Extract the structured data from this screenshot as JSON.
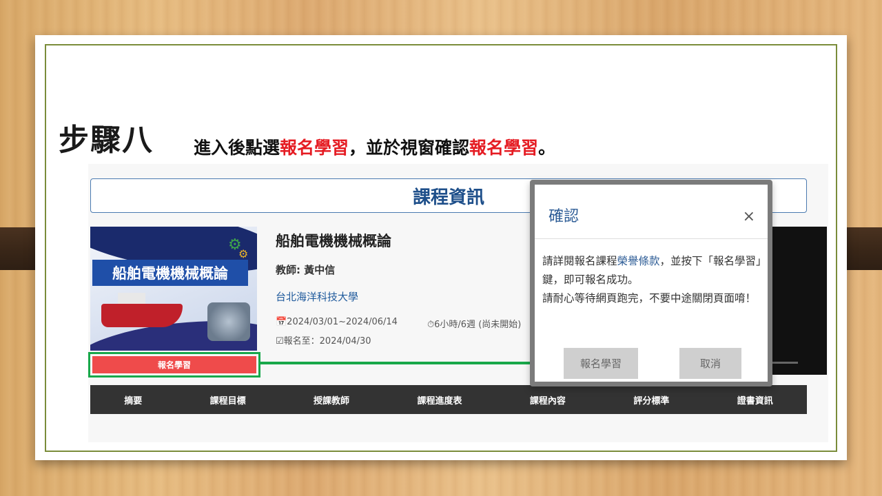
{
  "slide": {
    "step_title": "步驟八",
    "instruction": {
      "part1": "進入後點選",
      "highlight1": "報名學習",
      "part2": "，並於視窗確認",
      "highlight2": "報名學習",
      "part3": "。"
    }
  },
  "course_page": {
    "header": "課程資訊",
    "banner_label": "船舶電機機械概論",
    "course_name": "船舶電機機械概論",
    "teacher": "教師: 黃中信",
    "school": "台北海洋科技大學",
    "dates": "📅2024/03/01~2024/06/14",
    "duration": "⏱6小時/6週 (尚未開始)",
    "deadline": "☑報名至：2024/04/30",
    "enroll_button": "報名學習",
    "tabs": [
      "摘要",
      "課程目標",
      "授課教師",
      "課程進度表",
      "課程內容",
      "評分標準",
      "證書資訊"
    ]
  },
  "modal": {
    "title": "確認",
    "close": "×",
    "body_part1": "請詳閱報名課程",
    "body_link": "榮譽條款",
    "body_part2": "，並按下「報名學習」鍵，即可報名成功。",
    "body_line2": "請耐心等待網頁跑完，不要中途關閉頁面唷！",
    "confirm_button": "報名學習",
    "cancel_button": "取消"
  },
  "colors": {
    "highlight_red": "#e51c23",
    "enroll_red": "#ef4b4b",
    "arrow_green": "#18a84a",
    "link_blue": "#2d5c96"
  }
}
